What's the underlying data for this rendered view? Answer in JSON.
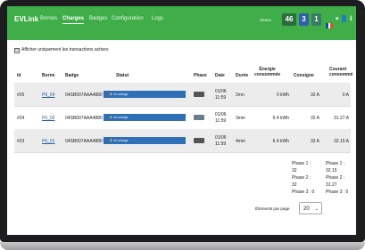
{
  "app": {
    "brand": "EVLink"
  },
  "nav": {
    "items": [
      "Bornes",
      "Charges",
      "Badges",
      "Configuration",
      "Logs"
    ],
    "active_index": 1
  },
  "header": {
    "status_label": "Status",
    "badges": [
      "46",
      "3",
      "1"
    ],
    "flag_colors": [
      "#0055a4",
      "#ffffff",
      "#ef4135"
    ]
  },
  "filter": {
    "checkbox_mark": "☑",
    "label": "Afficher uniquement les transactions actives"
  },
  "table": {
    "headers": {
      "id": "Id",
      "borne": "Borne",
      "badge": "Badge",
      "statut": "Statut",
      "phase": "Phase",
      "date": "Date",
      "duree": "Durée",
      "energie_1": "Énergie",
      "energie_2": "consommée",
      "consigne": "Consigne",
      "courant_1": "Courant",
      "courant_2": "consommé"
    },
    "rows": [
      {
        "id": "#25",
        "borne": "P6_04",
        "badge": "04SB607AAA4880",
        "statut": "en charge",
        "date_1": "01/06",
        "date_2": "11:59",
        "duree": "2mn",
        "energie": "0 kWh",
        "consigne": "32 A",
        "courant": "0 A"
      },
      {
        "id": "#24",
        "borne": "P6_02",
        "badge": "04SB607AAA4880",
        "statut": "en charge",
        "date_1": "01/06",
        "date_2": "11:59",
        "duree": "3min",
        "energie": "6.4 kWh",
        "consigne": "32 A",
        "courant": "31.27 A"
      },
      {
        "id": "#23",
        "borne": "P6_01",
        "badge": "04SB607AAA4880",
        "statut": "en charge",
        "date_1": "01/06",
        "date_2": "11:59",
        "duree": "4min",
        "energie": "6.4 kWh",
        "consigne": "32 A",
        "courant": "32.15 A"
      }
    ],
    "summary": {
      "consigne": [
        "Phase 1 :",
        "32",
        "Phase 2 :",
        "32",
        "Phase 3 : 0"
      ],
      "courant": [
        "Phase 1 :",
        "32.15",
        "Phase 2 :",
        "31.27",
        "Phase 3 : 0"
      ]
    }
  },
  "pager": {
    "label": "Éléments par page",
    "value": "20",
    "caret": "⌄"
  }
}
